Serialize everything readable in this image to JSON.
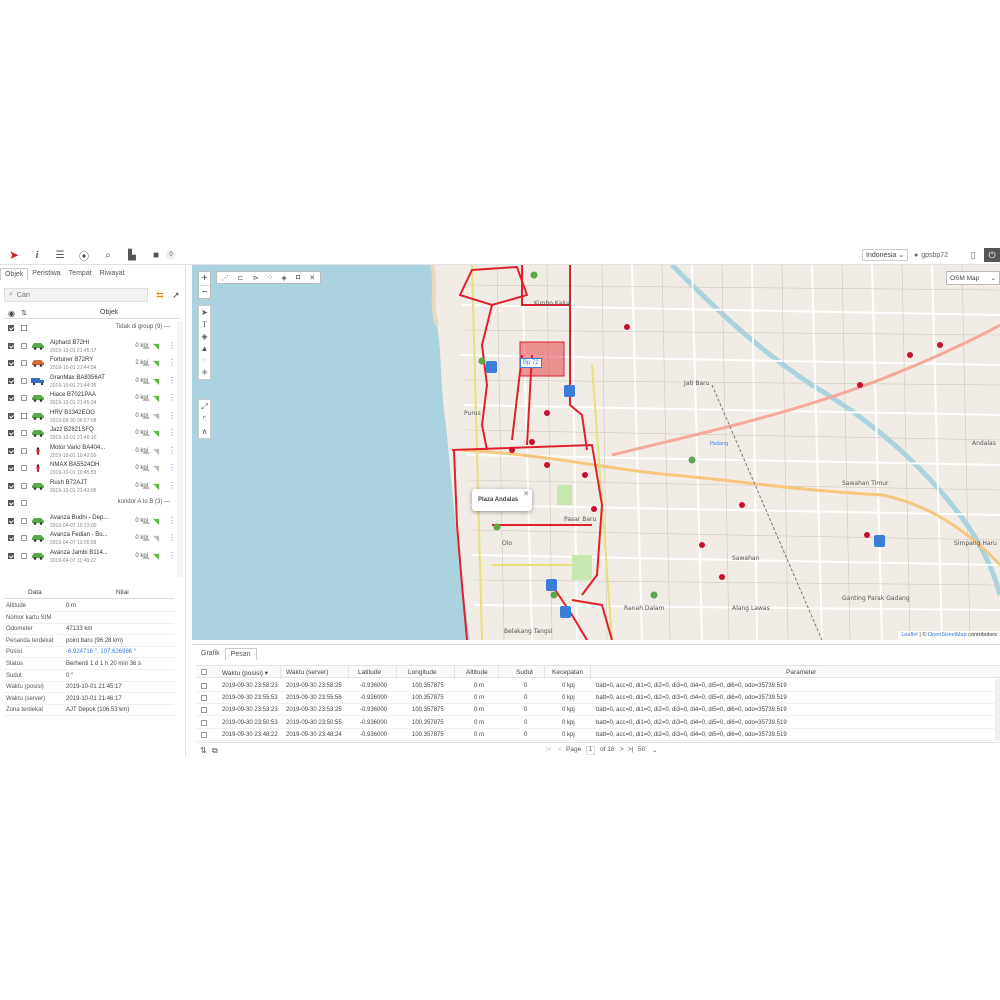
{
  "topbar": {
    "notif_count": "0",
    "language": "Indonesia",
    "username": "gpsbp72",
    "icons": [
      "logo-icon",
      "info-icon",
      "settings-icon",
      "location-icon",
      "search-icon",
      "chart-icon",
      "car-icon"
    ]
  },
  "left": {
    "tabs": [
      "Objek",
      "Peristiwa",
      "Tempat",
      "Riwayat"
    ],
    "search_placeholder": "Cari",
    "objects_header": "Objek",
    "groups": [
      {
        "label": "Tidak di group (9)",
        "toggle": "—"
      },
      {
        "label": "koridor A to B (3)",
        "toggle": "—"
      }
    ],
    "vehicles": [
      {
        "name": "Alphard B72HI",
        "time": "2019-10-01 21:45:17",
        "speed": "0 kpj",
        "type": "car",
        "color": "#5aa84a",
        "signal": "#5ab93c"
      },
      {
        "name": "Fortuner B72RY",
        "time": "2019-10-01 21:44:54",
        "speed": "2 kpj",
        "type": "car",
        "color": "#d06a3a",
        "signal": "#5ab93c"
      },
      {
        "name": "GranMax BA8356AT",
        "time": "2019-10-01 21:44:35",
        "speed": "0 kpj",
        "type": "truck",
        "color": "#3b6fc0",
        "signal": "#5ab93c"
      },
      {
        "name": "Hiace B7021PAA",
        "time": "2019-10-01 21:45:34",
        "speed": "0 kpj",
        "type": "car",
        "color": "#5aa84a",
        "signal": "#5ab93c"
      },
      {
        "name": "HRV B1342EOG",
        "time": "2019-09-30 06:57:08",
        "speed": "0 kpj",
        "type": "car",
        "color": "#5aa84a",
        "signal": "#bbbbbb"
      },
      {
        "name": "Jazz B2821SFQ",
        "time": "2019-10-01 21:46:10",
        "speed": "0 kpj",
        "type": "car",
        "color": "#5aa84a",
        "signal": "#5ab93c"
      },
      {
        "name": "Motor Vario BA404...",
        "time": "2019-10-01 10:42:59",
        "speed": "0 kpj",
        "type": "moto",
        "color": "#d3202a",
        "signal": "#bbbbbb"
      },
      {
        "name": "NMAX BA5524OH",
        "time": "2019-10-01 10:45:53",
        "speed": "0 kpj",
        "type": "moto",
        "color": "#d3202a",
        "signal": "#bbbbbb"
      },
      {
        "name": "Rush B72AJT",
        "time": "2019-10-01 21:43:06",
        "speed": "0 kpj",
        "type": "car",
        "color": "#5aa84a",
        "signal": "#5ab93c"
      },
      {
        "name": "Avanza Budhi - Dep...",
        "time": "2019-04-07 10:13:00",
        "speed": "0 kpj",
        "type": "car",
        "color": "#5aa84a",
        "signal": "#5ab93c"
      },
      {
        "name": "Avanza Fedian - Bo...",
        "time": "2019-04-07 13:05:58",
        "speed": "0 kpj",
        "type": "car",
        "color": "#5aa84a",
        "signal": "#bbbbbb"
      },
      {
        "name": "Avanza Jambi B114...",
        "time": "2019-04-07 11:49:22",
        "speed": "0 kpj",
        "type": "car",
        "color": "#5aa84a",
        "signal": "#5ab93c"
      }
    ],
    "data_header": {
      "col1": "Data",
      "col2": "Nilai"
    },
    "data_rows": [
      {
        "k": "Altitude",
        "v": "0 m"
      },
      {
        "k": "Nomor kartu SIM",
        "v": ""
      },
      {
        "k": "Odometer",
        "v": "47133 km"
      },
      {
        "k": "Penanda terdekat",
        "v": "point baru (96.28 km)"
      },
      {
        "k": "Posisi",
        "v": "-6.924716 °, 107.626986 °"
      },
      {
        "k": "Status",
        "v": "Berhenti 1 d 1 h 20 min 36 s"
      },
      {
        "k": "Sudut",
        "v": "0 °"
      },
      {
        "k": "Waktu (posisi)",
        "v": "2019-10-01 21:45:17"
      },
      {
        "k": "Waktu (server)",
        "v": "2019-10-01 21:46:17"
      },
      {
        "k": "Zona terdekat",
        "v": "AJT Depok (106.53 km)"
      }
    ]
  },
  "map": {
    "map_type": "OSM Map",
    "popup_title": "Plaza Andalas",
    "popup_close": "✕",
    "marker_label": "Bp 72",
    "attribution_leaflet": "Leaflet",
    "attribution_sep": " | © ",
    "attribution_osm": "OpenStreetMap",
    "attribution_rest": " contributors",
    "labels": [
      "Kimbo Kalua",
      "Jati Baru",
      "Padang",
      "Sawahan",
      "Sawahan Timur",
      "Simpang Haru",
      "Andalas",
      "Ganting Parak Gadang",
      "Alang Lawas",
      "Ranah Dalam",
      "Belakang Tangsi",
      "Pasar Baru",
      "Olo",
      "Purus"
    ]
  },
  "bottom": {
    "tabs": [
      "Grafik",
      "Pesan"
    ],
    "columns": [
      "Waktu (posisi) ▾",
      "Waktu (server)",
      "Latitude",
      "Longitude",
      "Altitude",
      "Sudut",
      "Kecepatan",
      "Parameter"
    ],
    "rows": [
      [
        "2019-09-30 23:58:23",
        "2019-09-30 23:58:25",
        "-0.936000",
        "100.357875",
        "0 m",
        "0",
        "0 kpj",
        "batt=0, acc=0, di1=0, di2=0, di3=0, di4=0, di5=0, di6=0, odo=35739.519"
      ],
      [
        "2019-09-30 23:55:53",
        "2019-09-30 23:55:56",
        "-0.936000",
        "100.357875",
        "0 m",
        "0",
        "0 kpj",
        "batt=0, acc=0, di1=0, di2=0, di3=0, di4=0, di5=0, di6=0, odo=35739.519"
      ],
      [
        "2019-09-30 23:53:23",
        "2019-09-30 23:53:25",
        "-0.936000",
        "100.357875",
        "0 m",
        "0",
        "0 kpj",
        "batt=0, acc=0, di1=0, di2=0, di3=0, di4=0, di5=0, di6=0, odo=35739.519"
      ],
      [
        "2019-09-30 23:50:53",
        "2019-09-30 23:50:55",
        "-0.936000",
        "100.357875",
        "0 m",
        "0",
        "0 kpj",
        "batt=0, acc=0, di1=0, di2=0, di3=0, di4=0, di5=0, di6=0, odo=35739.519"
      ],
      [
        "2019-09-30 23:48:22",
        "2019-09-30 23:48:24",
        "-0.936000",
        "100.357875",
        "0 m",
        "0",
        "0 kpj",
        "batt=0, acc=0, di1=0, di2=0, di3=0, di4=0, di5=0, di6=0, odo=35739.519"
      ]
    ],
    "pager": {
      "page_label": "Page",
      "page": "1",
      "of": "of 16",
      "per_page": "50"
    }
  }
}
